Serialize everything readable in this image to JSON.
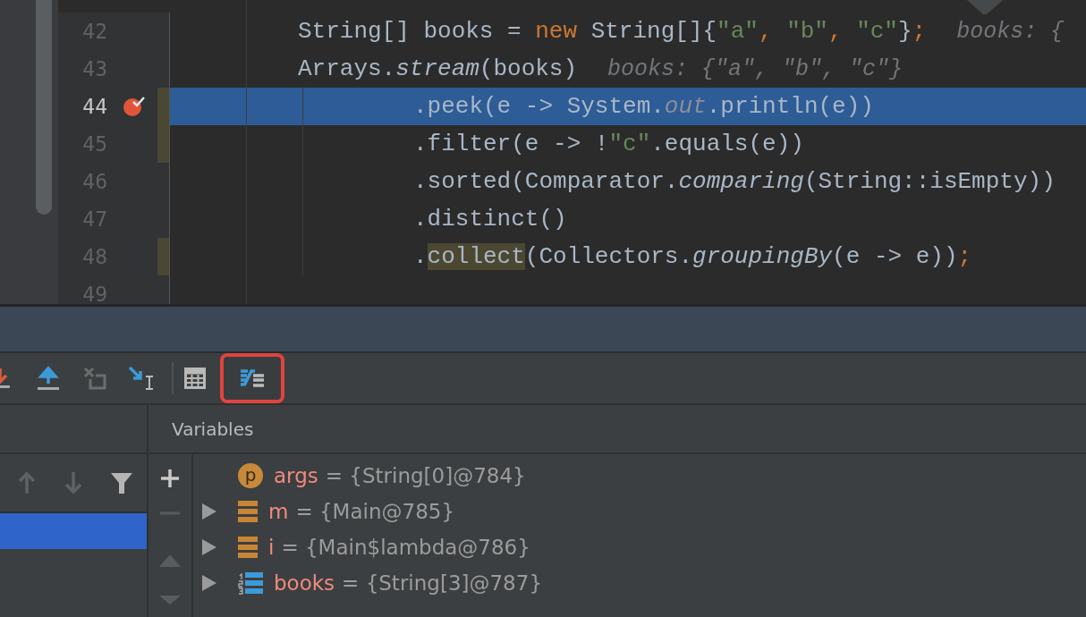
{
  "editor": {
    "lines": [
      {
        "number": "42",
        "kind": "statement",
        "current": false,
        "breakpoint": false,
        "changed": false,
        "tokens": [
          {
            "text": "String[] books = ",
            "kind": "plain"
          },
          {
            "text": "new",
            "kind": "keyword"
          },
          {
            "text": " String[]{",
            "kind": "plain"
          },
          {
            "text": "\"a\"",
            "kind": "string"
          },
          {
            "text": ", ",
            "kind": "keyword"
          },
          {
            "text": "\"b\"",
            "kind": "string"
          },
          {
            "text": ", ",
            "kind": "keyword"
          },
          {
            "text": "\"c\"",
            "kind": "string"
          },
          {
            "text": "}",
            "kind": "plain"
          },
          {
            "text": ";",
            "kind": "keyword"
          }
        ],
        "hint": "books: {"
      },
      {
        "number": "43",
        "kind": "statement",
        "current": false,
        "breakpoint": false,
        "changed": false,
        "tokens": [
          {
            "text": "Arrays.",
            "kind": "plain"
          },
          {
            "text": "stream",
            "kind": "italic"
          },
          {
            "text": "(books)",
            "kind": "plain"
          }
        ],
        "hint": "books: {\"a\", \"b\", \"c\"}"
      },
      {
        "number": "44",
        "kind": "chain",
        "current": true,
        "breakpoint": true,
        "changed": true,
        "tokens": [
          {
            "text": ".peek(e -> System.",
            "kind": "plain"
          },
          {
            "text": "out",
            "kind": "field"
          },
          {
            "text": ".println(e))",
            "kind": "plain"
          }
        ]
      },
      {
        "number": "45",
        "kind": "chain",
        "current": false,
        "breakpoint": false,
        "changed": true,
        "tokens": [
          {
            "text": ".filter(e -> !",
            "kind": "plain"
          },
          {
            "text": "\"c\"",
            "kind": "string"
          },
          {
            "text": ".equals(e))",
            "kind": "plain"
          }
        ]
      },
      {
        "number": "46",
        "kind": "chain",
        "current": false,
        "breakpoint": false,
        "changed": false,
        "tokens": [
          {
            "text": ".sorted(Comparator.",
            "kind": "plain"
          },
          {
            "text": "comparing",
            "kind": "italic"
          },
          {
            "text": "(String::isEmpty))",
            "kind": "plain"
          }
        ]
      },
      {
        "number": "47",
        "kind": "chain",
        "current": false,
        "breakpoint": false,
        "changed": false,
        "tokens": [
          {
            "text": ".distinct()",
            "kind": "plain"
          }
        ]
      },
      {
        "number": "48",
        "kind": "chain",
        "current": false,
        "breakpoint": false,
        "changed": true,
        "tokens": [
          {
            "text": ".",
            "kind": "plain"
          },
          {
            "text": "collect",
            "kind": "match"
          },
          {
            "text": "(Collectors.",
            "kind": "plain"
          },
          {
            "text": "groupingBy",
            "kind": "italic"
          },
          {
            "text": "(e -> e))",
            "kind": "plain"
          },
          {
            "text": ";",
            "kind": "keyword"
          }
        ]
      },
      {
        "number": "49",
        "current": false,
        "breakpoint": false,
        "changed": false
      }
    ]
  },
  "toolbar": {
    "buttons": [
      {
        "kind": "step-into",
        "selected": false
      },
      {
        "kind": "step-out",
        "selected": false
      },
      {
        "kind": "drop-frame",
        "selected": false
      },
      {
        "kind": "run-to-cursor",
        "selected": false
      },
      {
        "kind": "separator"
      },
      {
        "kind": "evaluate",
        "selected": false
      },
      {
        "kind": "trace-stream",
        "selected": true
      }
    ]
  },
  "frames": {
    "items": [
      {
        "selected": true
      }
    ]
  },
  "variables": {
    "title": "Variables",
    "items": [
      {
        "kind": "parameter",
        "badge": "p",
        "expandable": false,
        "name": "args",
        "value": "= {String[0]@784}"
      },
      {
        "kind": "field",
        "expandable": true,
        "name": "m",
        "value": "= {Main@785}"
      },
      {
        "kind": "field",
        "expandable": true,
        "name": "i",
        "value": "= {Main$lambda@786}"
      },
      {
        "kind": "array",
        "expandable": true,
        "name": "books",
        "value": "= {String[3]@787}"
      }
    ]
  }
}
